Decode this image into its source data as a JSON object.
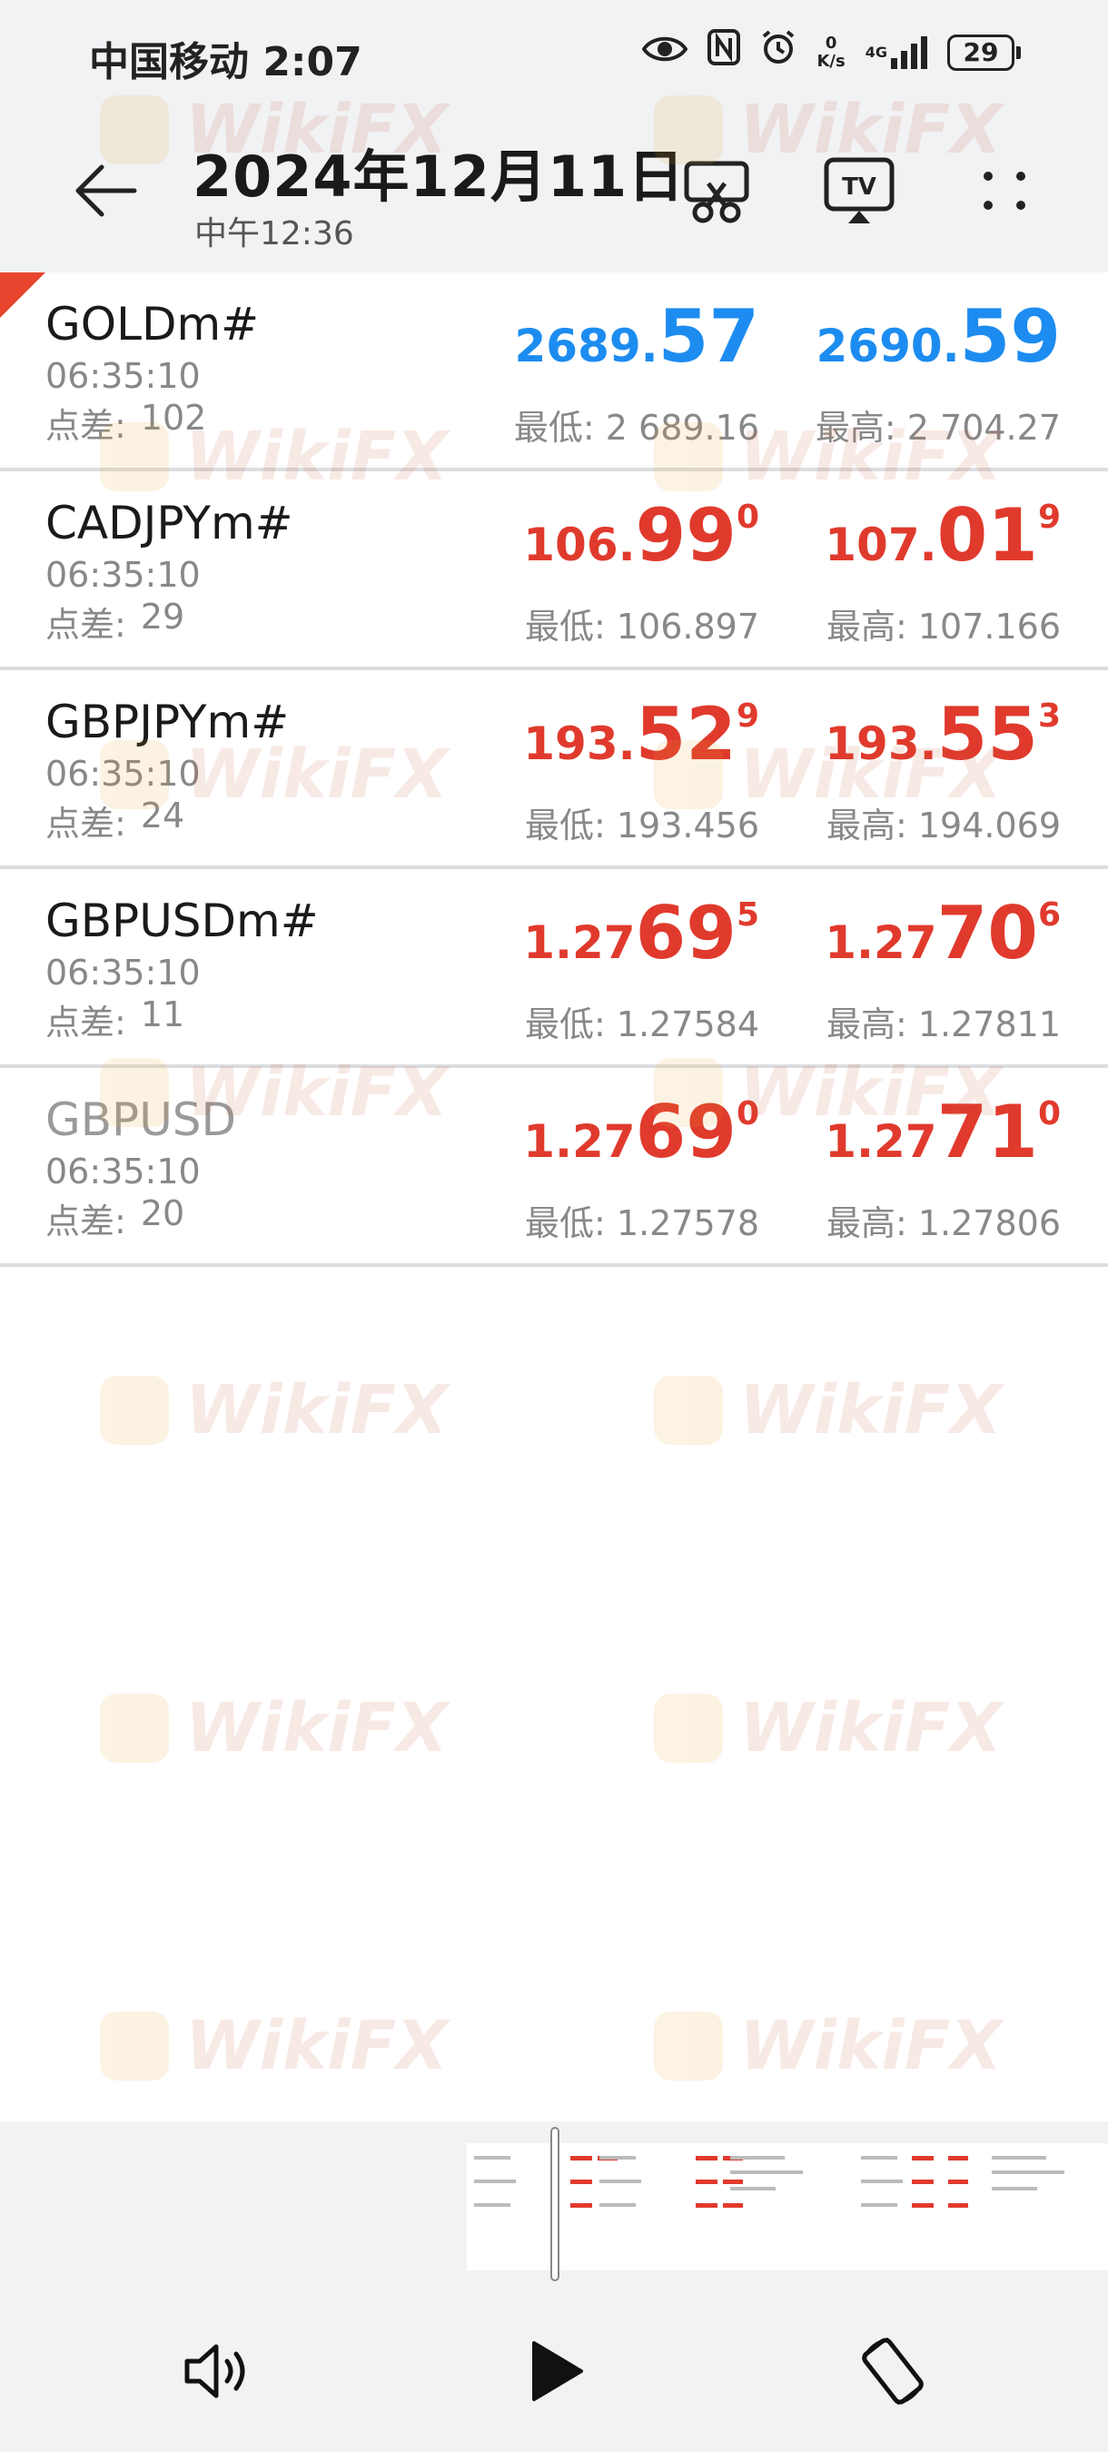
{
  "status_bar": {
    "carrier_time": "中国移动 2:07",
    "net_speed_value": "0",
    "net_speed_unit": "K/s",
    "network_label": "4G",
    "battery": "29"
  },
  "header": {
    "title": "2024年12月11日",
    "subtitle": "中午12:36"
  },
  "quotes": [
    {
      "symbol": "GOLDm#",
      "time": "06:35:10",
      "spread_label": "点差:",
      "spread": "102",
      "bid_small": "2689.",
      "bid_big": "57",
      "bid_sup": "",
      "ask_small": "2690.",
      "ask_big": "59",
      "ask_sup": "",
      "low": "最低: 2 689.16",
      "high": "最高: 2 704.27",
      "color": "blue",
      "dim": false
    },
    {
      "symbol": "CADJPYm#",
      "time": "06:35:10",
      "spread_label": "点差:",
      "spread": "29",
      "bid_small": "106.",
      "bid_big": "99",
      "bid_sup": "0",
      "ask_small": "107.",
      "ask_big": "01",
      "ask_sup": "9",
      "low": "最低: 106.897",
      "high": "最高: 107.166",
      "color": "red",
      "dim": false
    },
    {
      "symbol": "GBPJPYm#",
      "time": "06:35:10",
      "spread_label": "点差:",
      "spread": "24",
      "bid_small": "193.",
      "bid_big": "52",
      "bid_sup": "9",
      "ask_small": "193.",
      "ask_big": "55",
      "ask_sup": "3",
      "low": "最低: 193.456",
      "high": "最高: 194.069",
      "color": "red",
      "dim": false
    },
    {
      "symbol": "GBPUSDm#",
      "time": "06:35:10",
      "spread_label": "点差:",
      "spread": "11",
      "bid_small": "1.27",
      "bid_big": "69",
      "bid_sup": "5",
      "ask_small": "1.27",
      "ask_big": "70",
      "ask_sup": "6",
      "low": "最低: 1.27584",
      "high": "最高: 1.27811",
      "color": "red",
      "dim": false
    },
    {
      "symbol": "GBPUSD",
      "time": "06:35:10",
      "spread_label": "点差:",
      "spread": "20",
      "bid_small": "1.27",
      "bid_big": "69",
      "bid_sup": "0",
      "ask_small": "1.27",
      "ask_big": "71",
      "ask_sup": "0",
      "low": "最低: 1.27578",
      "high": "最高: 1.27806",
      "color": "red",
      "dim": true
    }
  ],
  "watermark": "WikiFX",
  "colors": {
    "bid_ask_up": "#1d8cf0",
    "bid_ask_down": "#e03a2d",
    "background_gray": "#f1f2f4"
  },
  "icons": {
    "back": "arrow-left-icon",
    "crop": "screenshot-crop-icon",
    "tv": "cast-tv-icon",
    "more": "more-dots-icon",
    "volume": "volume-icon",
    "play": "play-icon",
    "rotate": "rotate-screen-icon"
  }
}
